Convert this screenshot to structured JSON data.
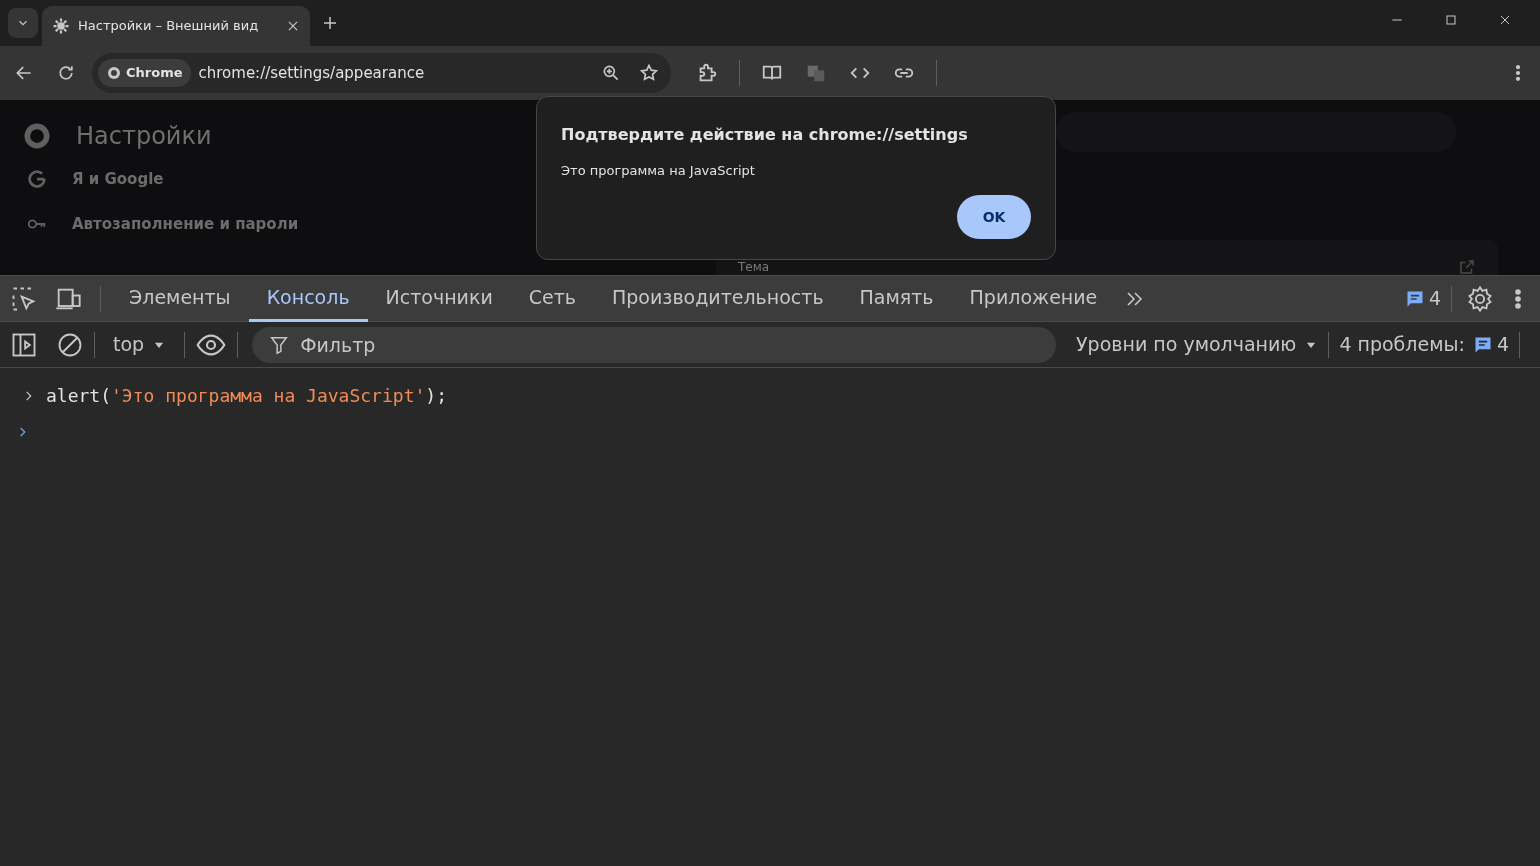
{
  "browser_tabs": [
    {
      "title": "Настройки – Внешний вид",
      "selected": true
    }
  ],
  "address_bar": {
    "chip": "Chrome",
    "url": "chrome://settings/appearance"
  },
  "settings": {
    "title": "Настройки",
    "nav_items": [
      {
        "label": "Я и Google"
      },
      {
        "label": "Автозаполнение и пароли"
      }
    ],
    "section_label": "Тема"
  },
  "dialog": {
    "title": "Подтвердите действие на chrome://settings",
    "message": "Это программа на JavaScript",
    "button": "OK"
  },
  "devtools": {
    "tabs": [
      {
        "label": "Элементы",
        "selected": false
      },
      {
        "label": "Консоль",
        "selected": true
      },
      {
        "label": "Источники",
        "selected": false
      },
      {
        "label": "Сеть",
        "selected": false
      },
      {
        "label": "Производительность",
        "selected": false
      },
      {
        "label": "Память",
        "selected": false
      },
      {
        "label": "Приложение",
        "selected": false
      }
    ],
    "issues_badge": "4",
    "console_toolbar": {
      "context": "top",
      "filter_placeholder": "Фильтр",
      "levels": "Уровни по умолчанию",
      "issues_label": "4 проблемы:",
      "issues_count": "4"
    },
    "console_lines": [
      {
        "kind": "input",
        "tokens": [
          {
            "kind": "code",
            "text": "alert("
          },
          {
            "kind": "string",
            "text": "'Это программа на JavaScript'"
          },
          {
            "kind": "code",
            "text": ");"
          }
        ]
      },
      {
        "kind": "prompt"
      }
    ]
  }
}
